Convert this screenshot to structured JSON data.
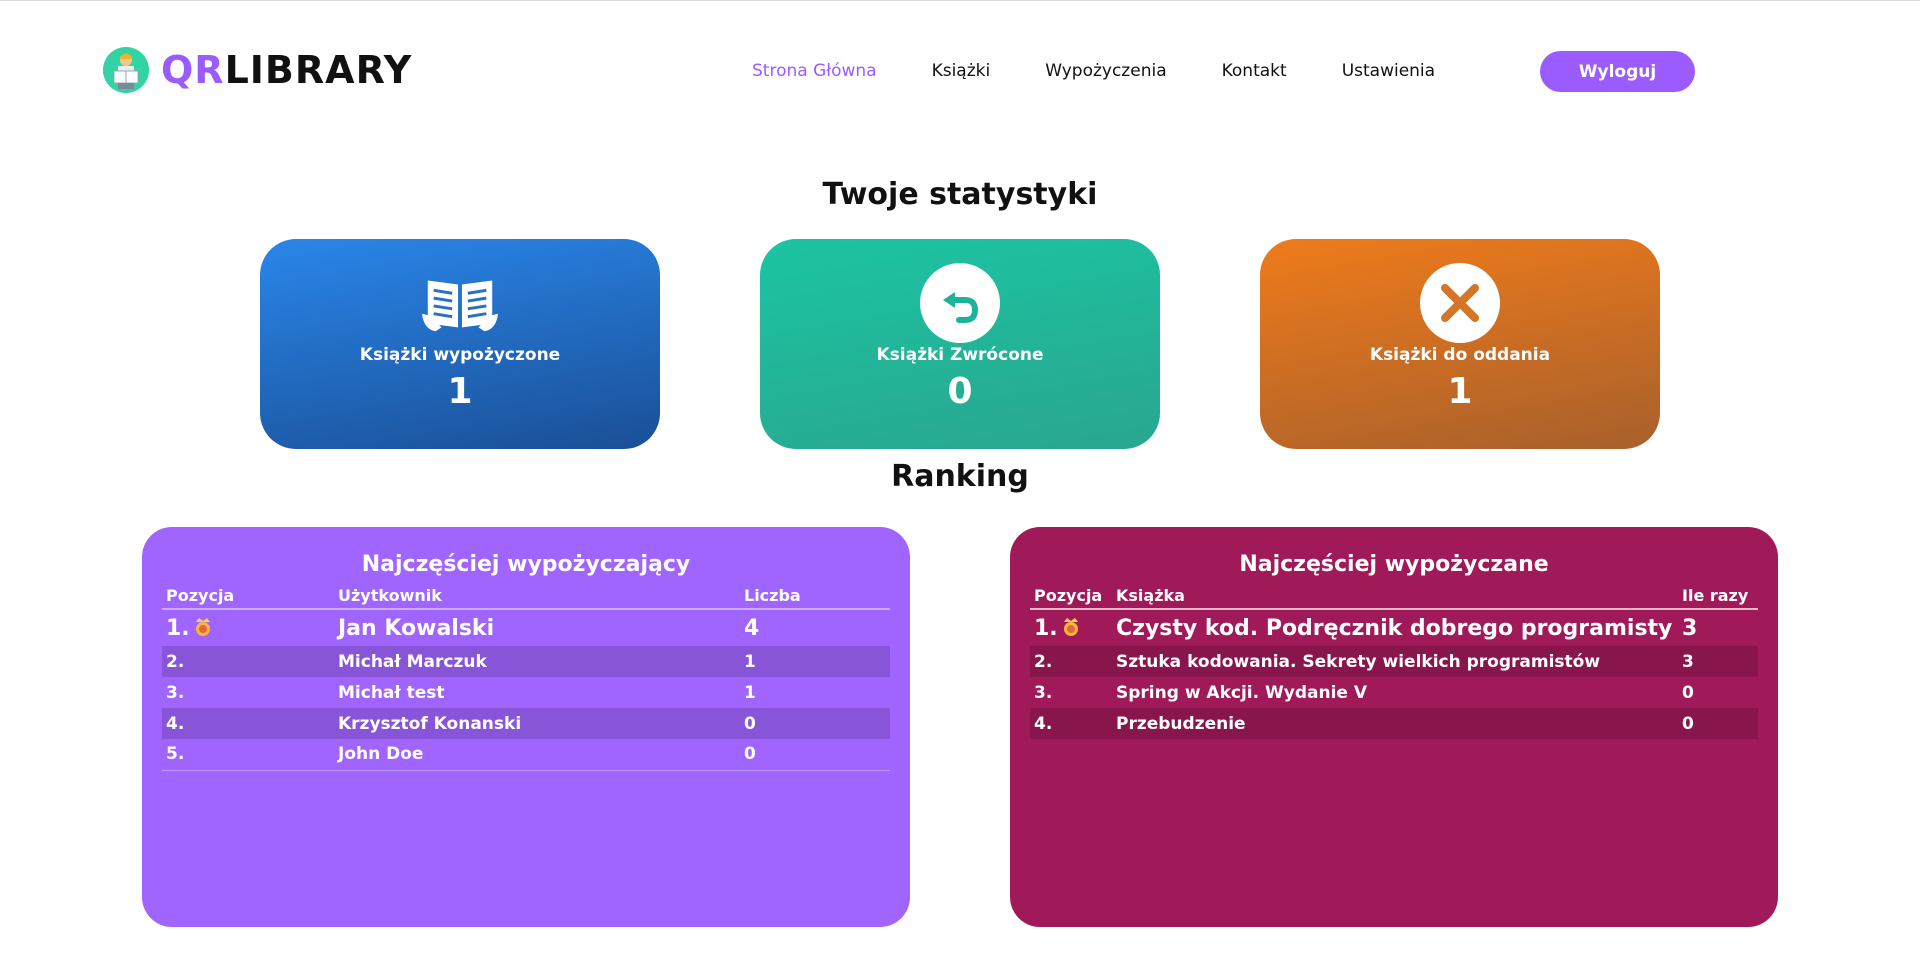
{
  "brand": {
    "name_part1": "QR",
    "name_part2": "LIBRARY"
  },
  "nav": {
    "items": [
      {
        "label": "Strona Główna",
        "active": true
      },
      {
        "label": "Książki",
        "active": false
      },
      {
        "label": "Wypożyczenia",
        "active": false
      },
      {
        "label": "Kontakt",
        "active": false
      },
      {
        "label": "Ustawienia",
        "active": false
      }
    ],
    "logout_label": "Wyloguj"
  },
  "stats": {
    "title": "Twoje statystyki",
    "cards": [
      {
        "label": "Książki wypożyczone",
        "value": "1",
        "icon": "open-book-icon"
      },
      {
        "label": "Książki Zwrócone",
        "value": "0",
        "icon": "undo-arrow-icon"
      },
      {
        "label": "Książki do oddania",
        "value": "1",
        "icon": "close-x-icon"
      }
    ]
  },
  "ranking": {
    "title": "Ranking",
    "users": {
      "title": "Najczęściej wypożyczający",
      "columns": [
        "Pozycja",
        "Użytkownik",
        "Liczba"
      ],
      "rows": [
        {
          "pos": "1.",
          "name": "Jan Kowalski",
          "count": "4"
        },
        {
          "pos": "2.",
          "name": "Michał Marczuk",
          "count": "1"
        },
        {
          "pos": "3.",
          "name": "Michał test",
          "count": "1"
        },
        {
          "pos": "4.",
          "name": "Krzysztof Konanski",
          "count": "0"
        },
        {
          "pos": "5.",
          "name": "John Doe",
          "count": "0"
        }
      ]
    },
    "books": {
      "title": "Najczęściej wypożyczane",
      "columns": [
        "Pozycja",
        "Książka",
        "Ile razy"
      ],
      "rows": [
        {
          "pos": "1.",
          "name": "Czysty kod. Podręcznik dobrego programisty",
          "count": "3"
        },
        {
          "pos": "2.",
          "name": "Sztuka kodowania. Sekrety wielkich programistów",
          "count": "3"
        },
        {
          "pos": "3.",
          "name": "Spring w Akcji. Wydanie V",
          "count": "0"
        },
        {
          "pos": "4.",
          "name": "Przebudzenie",
          "count": "0"
        }
      ]
    }
  },
  "colors": {
    "accent": "#9b5cff",
    "card_borrowed": "#2a86ea",
    "card_returned": "#1bc4a2",
    "card_due": "#ef7b1b",
    "panel_users": "#a064ff",
    "panel_books": "#a01a5a"
  }
}
